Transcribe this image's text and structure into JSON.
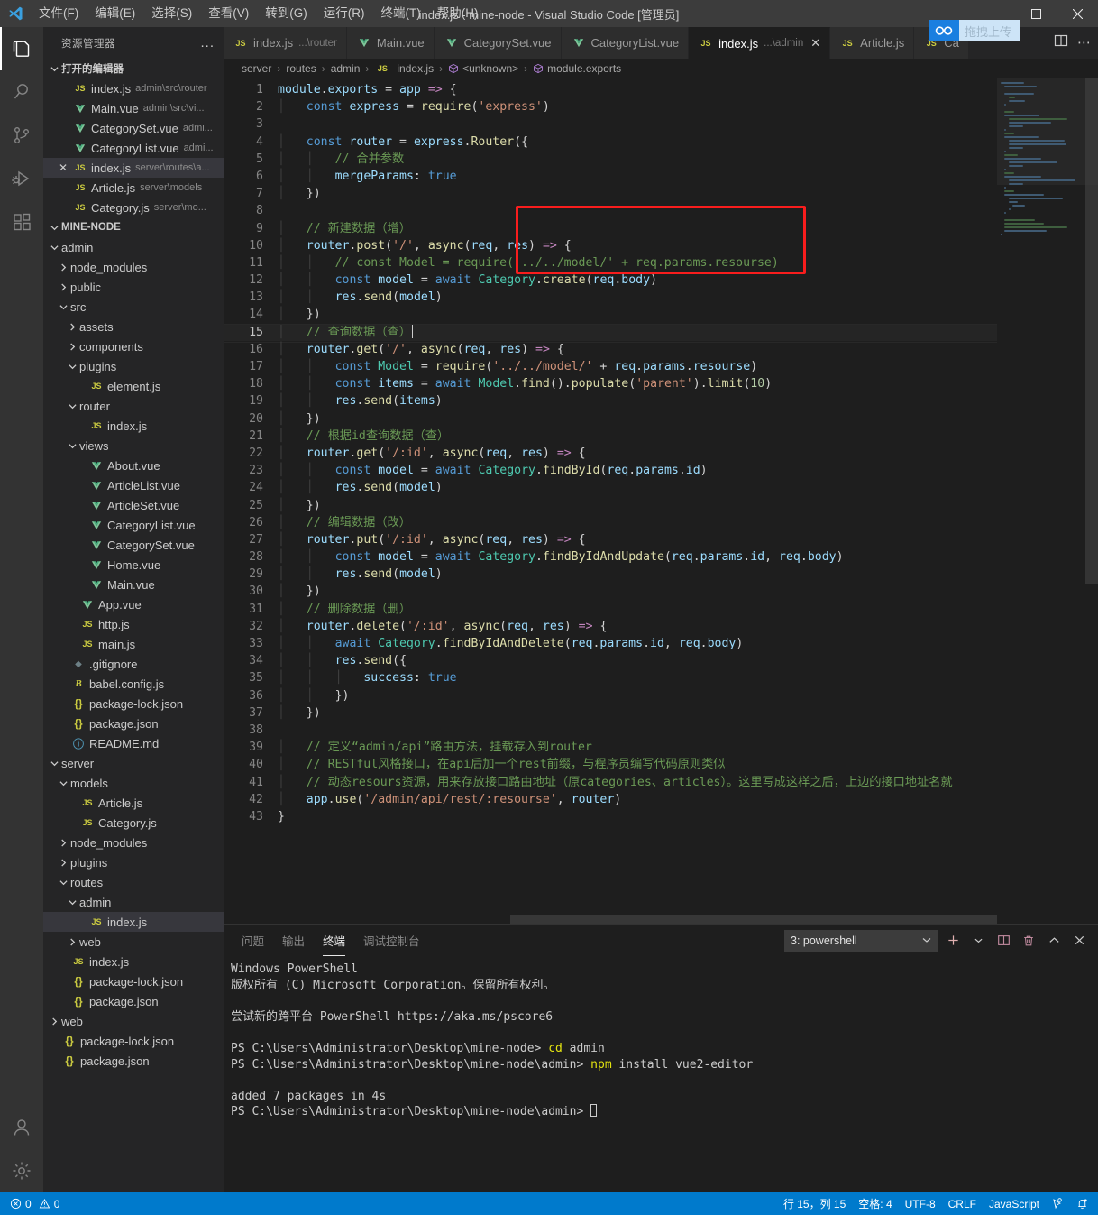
{
  "titlebar": {
    "window_title": "index.js - mine-node - Visual Studio Code [管理员]",
    "menus": [
      "文件(F)",
      "编辑(E)",
      "选择(S)",
      "查看(V)",
      "转到(G)",
      "运行(R)",
      "终端(T)",
      "帮助(H)"
    ],
    "minimize_label": "minimize",
    "maximize_label": "maximize",
    "close_label": "close"
  },
  "overlay": {
    "upload_label": "拖拽上传"
  },
  "activitybar": {
    "items": [
      {
        "name": "explorer",
        "icon": "files-icon",
        "active": true
      },
      {
        "name": "search",
        "icon": "search-icon",
        "active": false
      },
      {
        "name": "source-control",
        "icon": "source-control-icon",
        "active": false
      },
      {
        "name": "run-debug",
        "icon": "run-debug-icon",
        "active": false
      },
      {
        "name": "extensions",
        "icon": "extensions-icon",
        "active": false
      }
    ],
    "bottom": [
      {
        "name": "accounts",
        "icon": "account-icon"
      },
      {
        "name": "settings",
        "icon": "gear-icon"
      }
    ]
  },
  "sidebar": {
    "header": "资源管理器",
    "more_label": "...",
    "open_editors": {
      "label": "打开的编辑器",
      "items": [
        {
          "icon": "js",
          "name": "index.js",
          "path": "admin\\src\\router",
          "selected": false,
          "close": false
        },
        {
          "icon": "vue",
          "name": "Main.vue",
          "path": "admin\\src\\vi...",
          "selected": false,
          "close": false
        },
        {
          "icon": "vue",
          "name": "CategorySet.vue",
          "path": "admi...",
          "selected": false,
          "close": false
        },
        {
          "icon": "vue",
          "name": "CategoryList.vue",
          "path": "admi...",
          "selected": false,
          "close": false
        },
        {
          "icon": "js",
          "name": "index.js",
          "path": "server\\routes\\a...",
          "selected": true,
          "close": true
        },
        {
          "icon": "js",
          "name": "Article.js",
          "path": "server\\models",
          "selected": false,
          "close": false
        },
        {
          "icon": "js",
          "name": "Category.js",
          "path": "server\\mo...",
          "selected": false,
          "close": false
        }
      ]
    },
    "project": {
      "label": "MINE-NODE",
      "tree": [
        {
          "depth": 1,
          "type": "folder",
          "open": true,
          "name": "admin"
        },
        {
          "depth": 2,
          "type": "folder",
          "open": false,
          "name": "node_modules"
        },
        {
          "depth": 2,
          "type": "folder",
          "open": false,
          "name": "public"
        },
        {
          "depth": 2,
          "type": "folder",
          "open": true,
          "name": "src"
        },
        {
          "depth": 3,
          "type": "folder",
          "open": false,
          "name": "assets"
        },
        {
          "depth": 3,
          "type": "folder",
          "open": false,
          "name": "components"
        },
        {
          "depth": 3,
          "type": "folder",
          "open": true,
          "name": "plugins"
        },
        {
          "depth": 4,
          "type": "js",
          "name": "element.js"
        },
        {
          "depth": 3,
          "type": "folder",
          "open": true,
          "name": "router"
        },
        {
          "depth": 4,
          "type": "js",
          "name": "index.js"
        },
        {
          "depth": 3,
          "type": "folder",
          "open": true,
          "name": "views"
        },
        {
          "depth": 4,
          "type": "vue",
          "name": "About.vue"
        },
        {
          "depth": 4,
          "type": "vue",
          "name": "ArticleList.vue"
        },
        {
          "depth": 4,
          "type": "vue",
          "name": "ArticleSet.vue"
        },
        {
          "depth": 4,
          "type": "vue",
          "name": "CategoryList.vue"
        },
        {
          "depth": 4,
          "type": "vue",
          "name": "CategorySet.vue"
        },
        {
          "depth": 4,
          "type": "vue",
          "name": "Home.vue"
        },
        {
          "depth": 4,
          "type": "vue",
          "name": "Main.vue"
        },
        {
          "depth": 3,
          "type": "vue",
          "name": "App.vue"
        },
        {
          "depth": 3,
          "type": "js",
          "name": "http.js"
        },
        {
          "depth": 3,
          "type": "js",
          "name": "main.js"
        },
        {
          "depth": 2,
          "type": "git",
          "name": ".gitignore"
        },
        {
          "depth": 2,
          "type": "babel",
          "name": "babel.config.js"
        },
        {
          "depth": 2,
          "type": "json",
          "name": "package-lock.json"
        },
        {
          "depth": 2,
          "type": "json",
          "name": "package.json"
        },
        {
          "depth": 2,
          "type": "md",
          "name": "README.md"
        },
        {
          "depth": 1,
          "type": "folder",
          "open": true,
          "name": "server"
        },
        {
          "depth": 2,
          "type": "folder",
          "open": true,
          "name": "models"
        },
        {
          "depth": 3,
          "type": "js",
          "name": "Article.js"
        },
        {
          "depth": 3,
          "type": "js",
          "name": "Category.js"
        },
        {
          "depth": 2,
          "type": "folder",
          "open": false,
          "name": "node_modules"
        },
        {
          "depth": 2,
          "type": "folder",
          "open": false,
          "name": "plugins"
        },
        {
          "depth": 2,
          "type": "folder",
          "open": true,
          "name": "routes"
        },
        {
          "depth": 3,
          "type": "folder",
          "open": true,
          "name": "admin"
        },
        {
          "depth": 4,
          "type": "js",
          "name": "index.js",
          "selected": true
        },
        {
          "depth": 3,
          "type": "folder",
          "open": false,
          "name": "web"
        },
        {
          "depth": 2,
          "type": "js",
          "name": "index.js"
        },
        {
          "depth": 2,
          "type": "json",
          "name": "package-lock.json"
        },
        {
          "depth": 2,
          "type": "json",
          "name": "package.json"
        },
        {
          "depth": 1,
          "type": "folder",
          "open": false,
          "name": "web"
        },
        {
          "depth": 1,
          "type": "json",
          "name": "package-lock.json"
        },
        {
          "depth": 1,
          "type": "json",
          "name": "package.json"
        }
      ]
    }
  },
  "editor": {
    "tabs": [
      {
        "icon": "js",
        "label": "index.js",
        "sub": "...\\router",
        "active": false,
        "dirty": false
      },
      {
        "icon": "vue",
        "label": "Main.vue",
        "sub": "",
        "active": false,
        "dirty": false
      },
      {
        "icon": "vue",
        "label": "CategorySet.vue",
        "sub": "",
        "active": false,
        "dirty": false
      },
      {
        "icon": "vue",
        "label": "CategoryList.vue",
        "sub": "",
        "active": false,
        "dirty": false
      },
      {
        "icon": "js",
        "label": "index.js",
        "sub": "...\\admin",
        "active": true,
        "dirty": false
      },
      {
        "icon": "js",
        "label": "Article.js",
        "sub": "",
        "active": false,
        "dirty": false
      },
      {
        "icon": "js",
        "label": "Ca",
        "sub": "",
        "active": false,
        "dirty": false
      }
    ],
    "tab_actions": [
      {
        "name": "split-editor-icon"
      },
      {
        "name": "more-actions-icon"
      }
    ],
    "breadcrumb": [
      "server",
      "routes",
      "admin",
      "index.js",
      "<unknown>",
      "module.exports"
    ],
    "code_lines": [
      {
        "n": 1,
        "text": "module.exports = app => {"
      },
      {
        "n": 2,
        "text": "    const express = require('express')"
      },
      {
        "n": 3,
        "text": ""
      },
      {
        "n": 4,
        "text": "    const router = express.Router({"
      },
      {
        "n": 5,
        "text": "        // 合并参数"
      },
      {
        "n": 6,
        "text": "        mergeParams: true"
      },
      {
        "n": 7,
        "text": "    })"
      },
      {
        "n": 8,
        "text": ""
      },
      {
        "n": 9,
        "text": "    // 新建数据（增）"
      },
      {
        "n": 10,
        "text": "    router.post('/', async(req, res) => {"
      },
      {
        "n": 11,
        "text": "        // const Model = require('../../model/' + req.params.resourse)"
      },
      {
        "n": 12,
        "text": "        const model = await Category.create(req.body)"
      },
      {
        "n": 13,
        "text": "        res.send(model)"
      },
      {
        "n": 14,
        "text": "    })"
      },
      {
        "n": 15,
        "text": "    // 查询数据（查）"
      },
      {
        "n": 16,
        "text": "    router.get('/', async(req, res) => {"
      },
      {
        "n": 17,
        "text": "        const Model = require('../../model/' + req.params.resourse)"
      },
      {
        "n": 18,
        "text": "        const items = await Model.find().populate('parent').limit(10)"
      },
      {
        "n": 19,
        "text": "        res.send(items)"
      },
      {
        "n": 20,
        "text": "    })"
      },
      {
        "n": 21,
        "text": "    // 根据id查询数据（查）"
      },
      {
        "n": 22,
        "text": "    router.get('/:id', async(req, res) => {"
      },
      {
        "n": 23,
        "text": "        const model = await Category.findById(req.params.id)"
      },
      {
        "n": 24,
        "text": "        res.send(model)"
      },
      {
        "n": 25,
        "text": "    })"
      },
      {
        "n": 26,
        "text": "    // 编辑数据（改）"
      },
      {
        "n": 27,
        "text": "    router.put('/:id', async(req, res) => {"
      },
      {
        "n": 28,
        "text": "        const model = await Category.findByIdAndUpdate(req.params.id, req.body)"
      },
      {
        "n": 29,
        "text": "        res.send(model)"
      },
      {
        "n": 30,
        "text": "    })"
      },
      {
        "n": 31,
        "text": "    // 删除数据（删）"
      },
      {
        "n": 32,
        "text": "    router.delete('/:id', async(req, res) => {"
      },
      {
        "n": 33,
        "text": "        await Category.findByIdAndDelete(req.params.id, req.body)"
      },
      {
        "n": 34,
        "text": "        res.send({"
      },
      {
        "n": 35,
        "text": "            success: true"
      },
      {
        "n": 36,
        "text": "        })"
      },
      {
        "n": 37,
        "text": "    })"
      },
      {
        "n": 38,
        "text": ""
      },
      {
        "n": 39,
        "text": "    // 定义“admin/api”路由方法，挂载存入到router"
      },
      {
        "n": 40,
        "text": "    // RESTful风格接口，在api后加一个rest前缀，与程序员编写代码原则类似"
      },
      {
        "n": 41,
        "text": "    // 动态resours资源，用来存放接口路由地址（原categories、articles）。这里写成这样之后，上边的接口地址名就"
      },
      {
        "n": 42,
        "text": "    app.use('/admin/api/rest/:resourse', router)"
      },
      {
        "n": 43,
        "text": "}"
      }
    ],
    "highlight_color": "#f81d1d",
    "current_line": 15
  },
  "panel": {
    "tabs": [
      "问题",
      "输出",
      "终端",
      "调试控制台"
    ],
    "active_tab": "终端",
    "terminal_select": "3: powershell",
    "actions": [
      {
        "name": "new-terminal-icon",
        "label": "+"
      },
      {
        "name": "terminal-dropdown-icon",
        "label": "v"
      },
      {
        "name": "split-terminal-icon",
        "label": "split"
      },
      {
        "name": "kill-terminal-icon",
        "label": "trash"
      },
      {
        "name": "maximize-panel-icon",
        "label": "^"
      },
      {
        "name": "close-panel-icon",
        "label": "x"
      }
    ],
    "terminal_lines": [
      {
        "text": "Windows PowerShell"
      },
      {
        "text": "版权所有 (C) Microsoft Corporation。保留所有权利。"
      },
      {
        "text": ""
      },
      {
        "text": "尝试新的跨平台 PowerShell https://aka.ms/pscore6"
      },
      {
        "text": ""
      },
      {
        "prompt": "PS C:\\Users\\Administrator\\Desktop\\mine-node> ",
        "cmd": "cd",
        "args": " admin"
      },
      {
        "prompt": "PS C:\\Users\\Administrator\\Desktop\\mine-node\\admin> ",
        "cmd": "npm",
        "args": " install vue2-editor"
      },
      {
        "text": ""
      },
      {
        "text": "added 7 packages in 4s"
      },
      {
        "prompt": "PS C:\\Users\\Administrator\\Desktop\\mine-node\\admin> ",
        "cmd": "",
        "args": "",
        "cursor": true
      }
    ]
  },
  "statusbar": {
    "errors": "0",
    "warnings": "0",
    "position": "行 15，列 15",
    "indent": "空格: 4",
    "encoding": "UTF-8",
    "eol": "CRLF",
    "language": "JavaScript",
    "feedback_icon": "smiley-icon",
    "bell_icon": "bell-dot-icon",
    "accent": "#007acc"
  }
}
